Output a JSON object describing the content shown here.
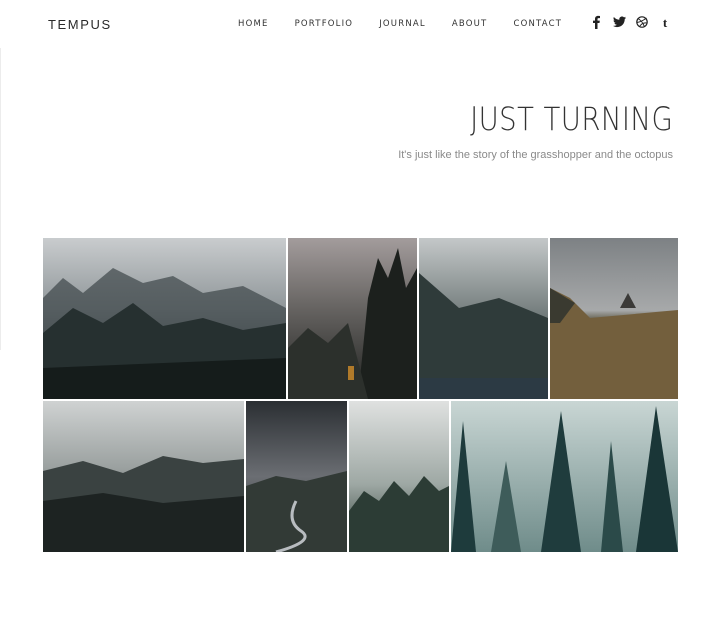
{
  "brand": {
    "logo": "TEMPUS"
  },
  "nav": {
    "items": [
      "HOME",
      "PORTFOLIO",
      "JOURNAL",
      "ABOUT",
      "CONTACT"
    ]
  },
  "social": {
    "icons": [
      "facebook-icon",
      "twitter-icon",
      "dribbble-icon",
      "tumblr-icon"
    ],
    "tumblr_glyph": "t"
  },
  "hero": {
    "title": "JUST TURNING",
    "subtitle": "It's just like the story of the grasshopper and the octopus"
  },
  "gallery": {
    "photos": [
      "misty-forest-hillside",
      "dark-pine-forest-fog",
      "mountain-lake-mist",
      "cabin-in-dry-grass",
      "clouded-mountain-ridge",
      "winding-road-valley",
      "foggy-treeline",
      "tall-spruce-forest"
    ]
  },
  "colors": {
    "text": "#222222",
    "muted": "#8a8a8a",
    "rule": "#ececec",
    "background": "#ffffff"
  }
}
